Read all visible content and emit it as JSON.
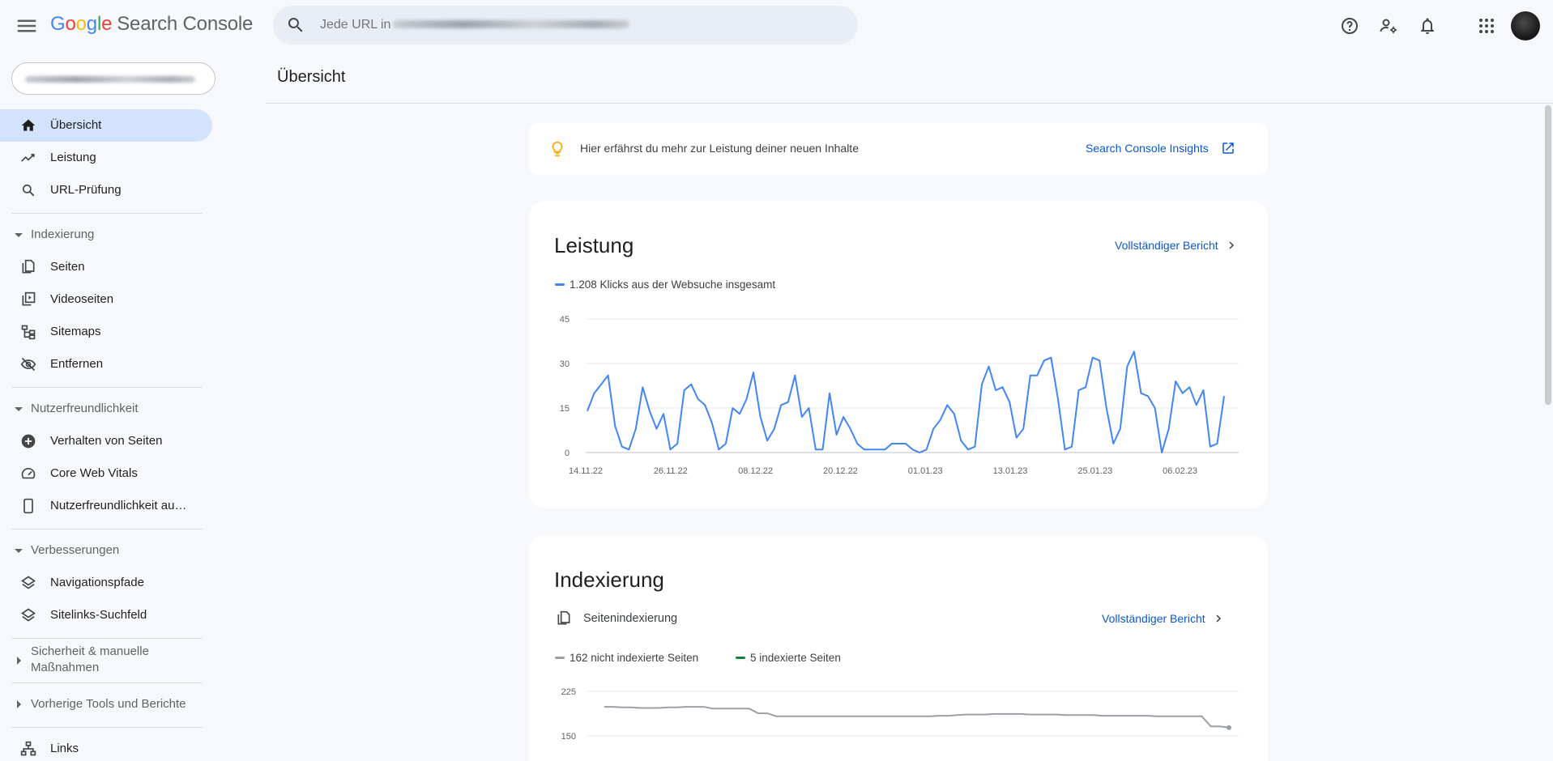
{
  "app": {
    "title_letters": [
      "G",
      "o",
      "o",
      "g",
      "l",
      "e"
    ],
    "product": "Search Console",
    "search_placeholder": "Jede URL in"
  },
  "topbar_icons": [
    "help-icon",
    "manage-users-icon",
    "notifications-icon",
    "apps-grid-icon"
  ],
  "sidebar": {
    "items": [
      {
        "label": "Übersicht",
        "icon": "home-icon",
        "active": true
      },
      {
        "label": "Leistung",
        "icon": "trending-up-icon"
      },
      {
        "label": "URL-Prüfung",
        "icon": "search-icon"
      }
    ],
    "sections": [
      {
        "title": "Indexierung",
        "expanded": true,
        "items": [
          {
            "label": "Seiten",
            "icon": "pages-icon"
          },
          {
            "label": "Videoseiten",
            "icon": "video-pages-icon"
          },
          {
            "label": "Sitemaps",
            "icon": "sitemap-icon"
          },
          {
            "label": "Entfernen",
            "icon": "visibility-off-icon"
          }
        ]
      },
      {
        "title": "Nutzerfreundlichkeit",
        "expanded": true,
        "items": [
          {
            "label": "Verhalten von Seiten",
            "icon": "add-circle-icon"
          },
          {
            "label": "Core Web Vitals",
            "icon": "speed-icon"
          },
          {
            "label": "Nutzerfreundlichkeit au…",
            "icon": "smartphone-icon"
          }
        ]
      },
      {
        "title": "Verbesserungen",
        "expanded": true,
        "items": [
          {
            "label": "Navigationspfade",
            "icon": "layers-icon"
          },
          {
            "label": "Sitelinks-Suchfeld",
            "icon": "layers-icon"
          }
        ]
      },
      {
        "title_line1": "Sicherheit & manuelle",
        "title_line2": "Maßnahmen",
        "expanded": false
      },
      {
        "title": "Vorherige Tools und Berichte",
        "expanded": false
      }
    ],
    "bottom_item": {
      "label": "Links",
      "icon": "links-icon"
    }
  },
  "main": {
    "page_title": "Übersicht",
    "insight": {
      "text": "Hier erfährst du mehr zur Leistung deiner neuen Inhalte",
      "link": "Search Console Insights"
    },
    "performance": {
      "title": "Leistung",
      "link": "Vollständiger Bericht",
      "legend": "1.208 Klicks aus der Websuche insgesamt",
      "color": "#4285f4"
    },
    "indexing": {
      "title": "Indexierung",
      "subtitle": "Seitenindexierung",
      "link": "Vollständiger Bericht",
      "legend_not_indexed": "162 nicht indexierte Seiten",
      "legend_indexed": "5 indexierte Seiten",
      "color_not_indexed": "#9aa0a6",
      "color_indexed": "#188038"
    }
  },
  "chart_data": [
    {
      "type": "line",
      "title": "",
      "series": [
        {
          "name": "1.208 Klicks aus der Websuche insgesamt",
          "values": [
            14,
            20,
            23,
            26,
            9,
            2,
            1,
            8,
            22,
            14,
            8,
            13,
            1,
            3,
            21,
            23,
            18,
            16,
            10,
            1,
            3,
            15,
            13,
            18,
            27,
            12,
            4,
            8,
            16,
            17,
            26,
            12,
            15,
            1,
            1,
            20,
            6,
            12,
            8,
            3,
            1,
            1,
            1,
            1,
            3,
            3,
            3,
            1,
            0,
            1,
            8,
            11,
            16,
            13,
            4,
            1,
            2,
            23,
            29,
            21,
            22,
            17,
            5,
            8,
            26,
            26,
            31,
            32,
            18,
            1,
            2,
            21,
            22,
            32,
            31,
            15,
            3,
            8,
            29,
            34,
            20,
            19,
            15,
            0,
            8,
            24,
            20,
            22,
            16,
            21,
            2,
            3,
            19
          ]
        }
      ],
      "x_tick_labels": [
        "14.11.22",
        "26.11.22",
        "08.12.22",
        "20.12.22",
        "01.01.23",
        "13.01.23",
        "25.01.23",
        "06.02.23"
      ],
      "ylim": [
        0,
        45
      ],
      "y_ticks": [
        0,
        15,
        30,
        45
      ],
      "grid": true
    },
    {
      "type": "line",
      "title": "",
      "series": [
        {
          "name": "162 nicht indexierte Seiten",
          "values": [
            199,
            199,
            198,
            198,
            197,
            197,
            197,
            198,
            198,
            199,
            199,
            199,
            196,
            196,
            196,
            196,
            196,
            188,
            188,
            183,
            183,
            183,
            183,
            183,
            183,
            183,
            183,
            183,
            183,
            183,
            183,
            183,
            183,
            183,
            183,
            183,
            183,
            184,
            184,
            185,
            186,
            186,
            186,
            187,
            187,
            187,
            187,
            186,
            186,
            186,
            186,
            185,
            185,
            185,
            185,
            184,
            184,
            184,
            184,
            184,
            184,
            183,
            183,
            183,
            183,
            183,
            183,
            166,
            166,
            164
          ]
        },
        {
          "name": "5 indexierte Seiten",
          "values": []
        }
      ],
      "y_ticks": [
        150,
        225
      ],
      "grid": true
    }
  ]
}
